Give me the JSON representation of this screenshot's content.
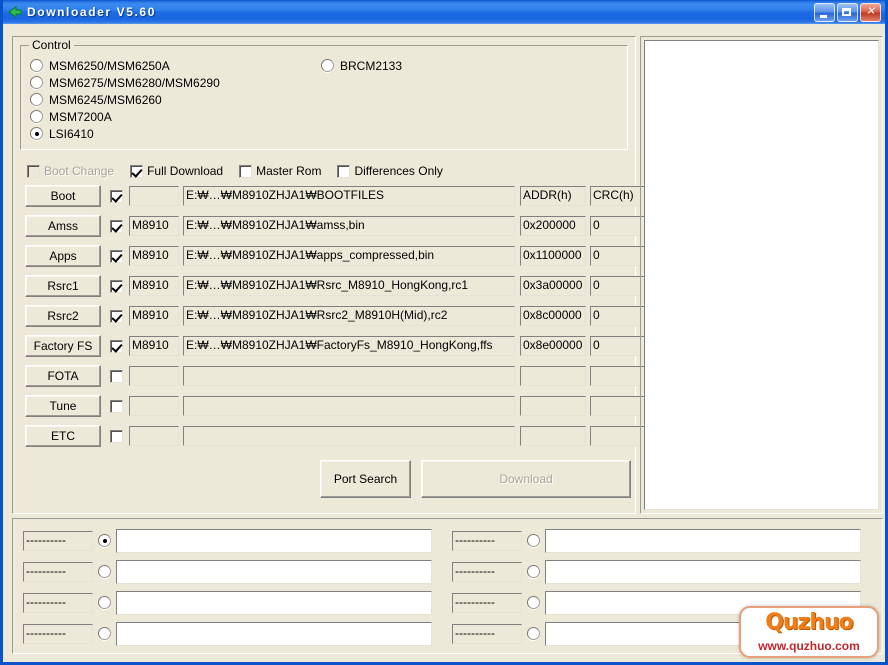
{
  "window": {
    "title": "Downloader V5.60",
    "icon": "download-arrow-icon",
    "minimize_label": "Minimize",
    "maximize_label": "Maximize",
    "close_label": "Close"
  },
  "control_group": {
    "title": "Control",
    "chipsets_left": [
      {
        "label": "MSM6250/MSM6250A",
        "selected": false
      },
      {
        "label": "MSM6275/MSM6280/MSM6290",
        "selected": false
      },
      {
        "label": "MSM6245/MSM6260",
        "selected": false
      },
      {
        "label": "MSM7200A",
        "selected": false
      },
      {
        "label": "LSI6410",
        "selected": true
      }
    ],
    "chipsets_right": [
      {
        "label": "BRCM2133",
        "selected": false
      }
    ]
  },
  "options": [
    {
      "label": "Boot Change",
      "checked": false,
      "disabled": true
    },
    {
      "label": "Full Download",
      "checked": true,
      "disabled": false
    },
    {
      "label": "Master Rom",
      "checked": false,
      "disabled": false
    },
    {
      "label": "Differences Only",
      "checked": false,
      "disabled": false
    }
  ],
  "headers": {
    "addr": "ADDR(h)",
    "crc": "CRC(h)"
  },
  "file_rows": [
    {
      "button": "Boot",
      "checked": true,
      "model": "",
      "path": "E:₩…₩M8910ZHJA1₩BOOTFILES",
      "addr": "ADDR(h)",
      "crc": "CRC(h)",
      "is_header_row": true
    },
    {
      "button": "Amss",
      "checked": true,
      "model": "M8910",
      "path": "E:₩…₩M8910ZHJA1₩amss,bin",
      "addr": "0x200000",
      "crc": "0"
    },
    {
      "button": "Apps",
      "checked": true,
      "model": "M8910",
      "path": "E:₩…₩M8910ZHJA1₩apps_compressed,bin",
      "addr": "0x1100000",
      "crc": "0"
    },
    {
      "button": "Rsrc1",
      "checked": true,
      "model": "M8910",
      "path": "E:₩…₩M8910ZHJA1₩Rsrc_M8910_HongKong,rc1",
      "addr": "0x3a00000",
      "crc": "0"
    },
    {
      "button": "Rsrc2",
      "checked": true,
      "model": "M8910",
      "path": "E:₩…₩M8910ZHJA1₩Rsrc2_M8910H(Mid),rc2",
      "addr": "0x8c00000",
      "crc": "0"
    },
    {
      "button": "Factory FS",
      "checked": true,
      "model": "M8910",
      "path": "E:₩…₩M8910ZHJA1₩FactoryFs_M8910_HongKong,ffs",
      "addr": "0x8e00000",
      "crc": "0"
    },
    {
      "button": "FOTA",
      "checked": false,
      "model": "",
      "path": "",
      "addr": "",
      "crc": ""
    },
    {
      "button": "Tune",
      "checked": false,
      "model": "",
      "path": "",
      "addr": "",
      "crc": ""
    },
    {
      "button": "ETC",
      "checked": false,
      "model": "",
      "path": "",
      "addr": "",
      "crc": ""
    }
  ],
  "actions": {
    "port_search": "Port Search",
    "download": "Download",
    "download_disabled": true
  },
  "log_panel": {
    "text": ""
  },
  "ports_left": [
    {
      "label": "----------",
      "selected": true,
      "status": ""
    },
    {
      "label": "----------",
      "selected": false,
      "status": ""
    },
    {
      "label": "----------",
      "selected": false,
      "status": ""
    },
    {
      "label": "----------",
      "selected": false,
      "status": ""
    }
  ],
  "ports_right": [
    {
      "label": "----------",
      "selected": false,
      "status": ""
    },
    {
      "label": "----------",
      "selected": false,
      "status": ""
    },
    {
      "label": "----------",
      "selected": false,
      "status": ""
    },
    {
      "label": "----------",
      "selected": false,
      "status": ""
    }
  ],
  "watermark": {
    "brand": "Quzhuo",
    "url": "www.quzhuo.com"
  },
  "colors": {
    "titlebar": "#1D6BE4",
    "face": "#ECE9D8",
    "border": "#0A53C8",
    "accent": "#F07D18",
    "close": "#BE3A22"
  }
}
